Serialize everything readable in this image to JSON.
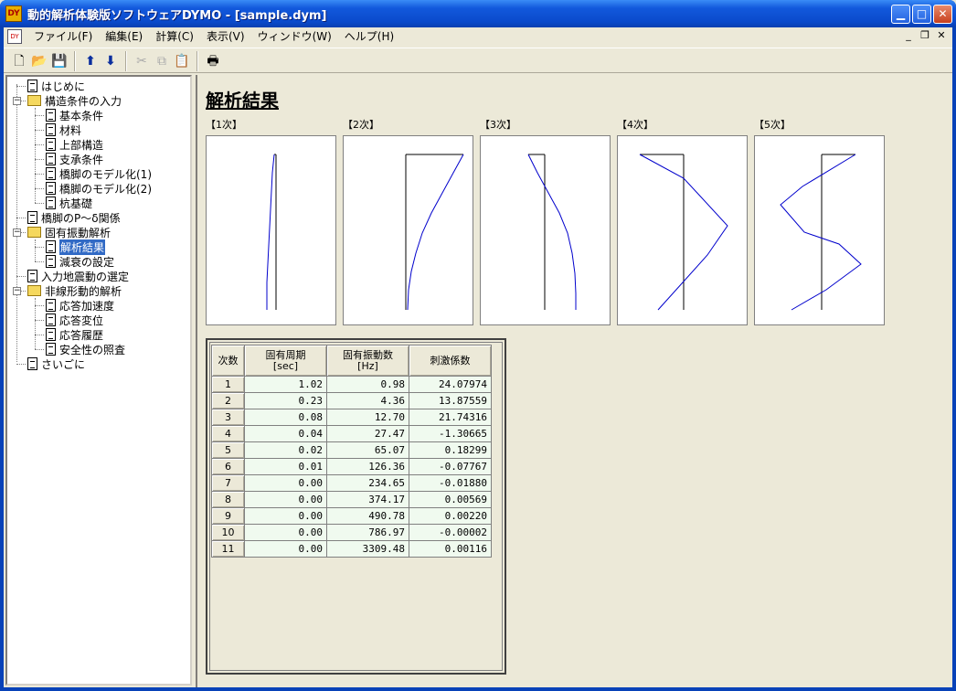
{
  "window": {
    "title": "動的解析体験版ソフトウェアDYMO - [sample.dym]",
    "icon_text": "DY"
  },
  "menu": [
    "ファイル(F)",
    "編集(E)",
    "計算(C)",
    "表示(V)",
    "ウィンドウ(W)",
    "ヘルプ(H)"
  ],
  "tree": [
    {
      "label": "はじめに",
      "level": 0,
      "type": "doc"
    },
    {
      "label": "構造条件の入力",
      "level": 0,
      "type": "folder"
    },
    {
      "label": "基本条件",
      "level": 1,
      "type": "doc"
    },
    {
      "label": "材料",
      "level": 1,
      "type": "doc"
    },
    {
      "label": "上部構造",
      "level": 1,
      "type": "doc"
    },
    {
      "label": "支承条件",
      "level": 1,
      "type": "doc"
    },
    {
      "label": "橋脚のモデル化(1)",
      "level": 1,
      "type": "doc"
    },
    {
      "label": "橋脚のモデル化(2)",
      "level": 1,
      "type": "doc"
    },
    {
      "label": "杭基礎",
      "level": 1,
      "type": "doc"
    },
    {
      "label": "橋脚のP～δ関係",
      "level": 0,
      "type": "doc"
    },
    {
      "label": "固有振動解析",
      "level": 0,
      "type": "folder"
    },
    {
      "label": "解析結果",
      "level": 1,
      "type": "doc",
      "selected": true
    },
    {
      "label": "減衰の設定",
      "level": 1,
      "type": "doc"
    },
    {
      "label": "入力地震動の選定",
      "level": 0,
      "type": "doc"
    },
    {
      "label": "非線形動的解析",
      "level": 0,
      "type": "folder"
    },
    {
      "label": "応答加速度",
      "level": 1,
      "type": "doc"
    },
    {
      "label": "応答変位",
      "level": 1,
      "type": "doc"
    },
    {
      "label": "応答履歴",
      "level": 1,
      "type": "doc"
    },
    {
      "label": "安全性の照査",
      "level": 1,
      "type": "doc"
    },
    {
      "label": "さいごに",
      "level": 0,
      "type": "doc"
    }
  ],
  "main": {
    "title": "解析結果",
    "modes": [
      "【1次】",
      "【2次】",
      "【3次】",
      "【4次】",
      "【5次】"
    ]
  },
  "table": {
    "headers": [
      "次数",
      "固有周期\n[sec]",
      "固有振動数\n[Hz]",
      "刺激係数"
    ],
    "rows": [
      [
        "1",
        "1.02",
        "0.98",
        "24.07974"
      ],
      [
        "2",
        "0.23",
        "4.36",
        "13.87559"
      ],
      [
        "3",
        "0.08",
        "12.70",
        "21.74316"
      ],
      [
        "4",
        "0.04",
        "27.47",
        "-1.30665"
      ],
      [
        "5",
        "0.02",
        "65.07",
        "0.18299"
      ],
      [
        "6",
        "0.01",
        "126.36",
        "-0.07767"
      ],
      [
        "7",
        "0.00",
        "234.65",
        "-0.01880"
      ],
      [
        "8",
        "0.00",
        "374.17",
        "0.00569"
      ],
      [
        "9",
        "0.00",
        "490.78",
        "0.00220"
      ],
      [
        "10",
        "0.00",
        "786.97",
        "-0.00002"
      ],
      [
        "11",
        "0.00",
        "3309.48",
        "0.00116"
      ]
    ]
  },
  "colors": {
    "mode_line": "#0000CC",
    "axis_line": "#000000",
    "selected": "#316AC5"
  }
}
